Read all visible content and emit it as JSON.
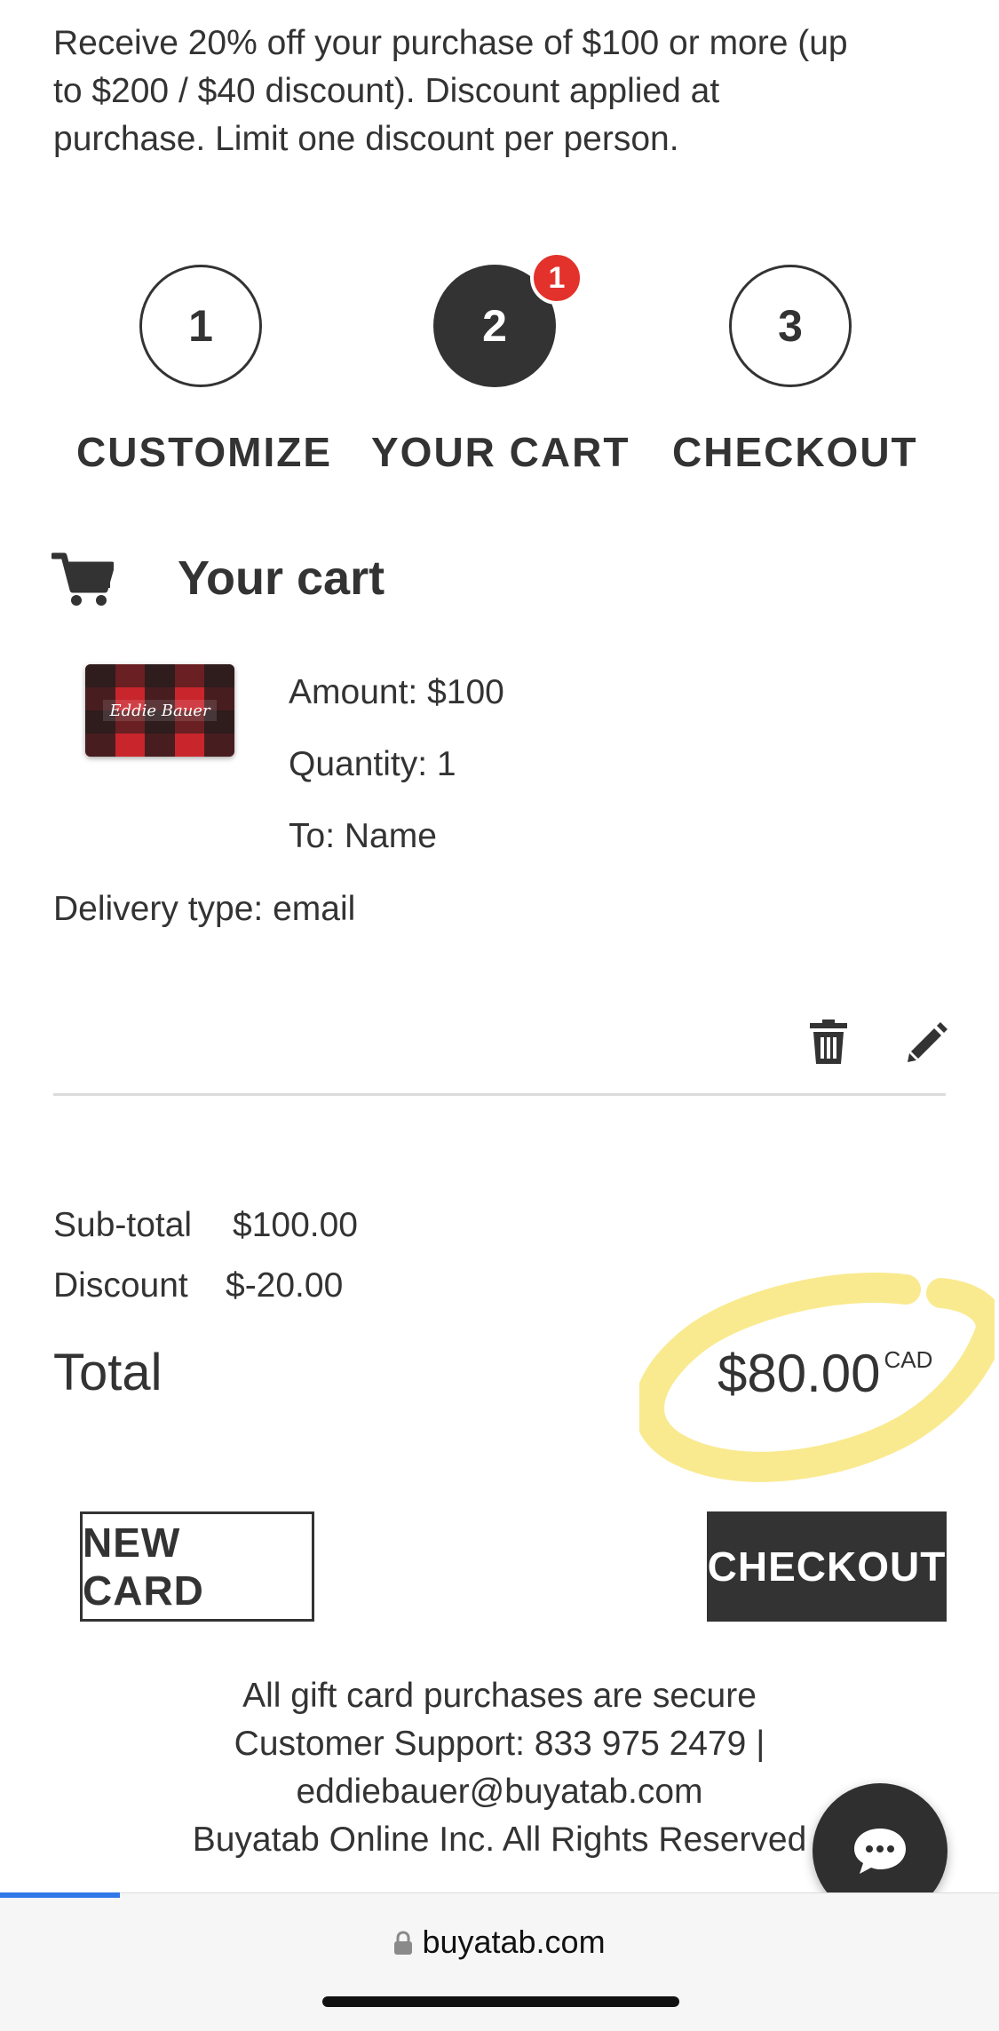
{
  "promo": {
    "line1": "Receive 20% off your purchase of $100 or more (up",
    "line2": "to $200 / $40 discount). Discount applied at",
    "line3": "purchase. Limit one discount per person."
  },
  "steps": [
    {
      "number": "1",
      "label": "CUSTOMIZE",
      "active": false
    },
    {
      "number": "2",
      "label": "YOUR CART",
      "active": true,
      "badge": "1"
    },
    {
      "number": "3",
      "label": "CHECKOUT",
      "active": false
    }
  ],
  "cart": {
    "title": "Your cart",
    "item": {
      "amount": "Amount: $100",
      "quantity": "Quantity: 1",
      "to": "To: Name",
      "delivery": "Delivery type: email",
      "card_logo": "Eddie Bauer"
    }
  },
  "summary": {
    "subtotal_label": "Sub-total",
    "subtotal_value": "$100.00",
    "discount_label": "Discount",
    "discount_value": "$-20.00",
    "total_label": "Total",
    "total_value": "$80.00",
    "currency": "CAD"
  },
  "buttons": {
    "new_card": "NEW CARD",
    "checkout": "CHECKOUT"
  },
  "footer": {
    "line1": "All gift card purchases are secure",
    "line2": "Customer Support: 833 975 2479 |",
    "line3": "eddiebauer@buyatab.com",
    "line4": "Buyatab Online Inc. All Rights Reserved"
  },
  "browser": {
    "url": "buyatab.com"
  },
  "colors": {
    "dark": "#333333",
    "badge": "#e3322b",
    "highlight": "#f7e36a",
    "progress": "#2f78e8"
  }
}
